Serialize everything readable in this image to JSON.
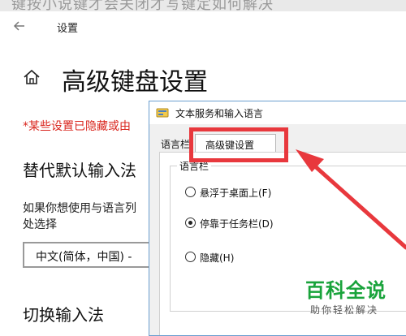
{
  "top_strip_text": "键按小说键才会关闭才写键定如何解决",
  "settings": {
    "title": "设置",
    "page_title": "高级键盘设置",
    "notice": "*某些设置已隐藏或由",
    "section1_heading": "替代默认输入法",
    "section1_desc_line1": "如果你想使用与语言列",
    "section1_desc_line2": "处选择",
    "input_method_select": "中文(简体，中国) -",
    "section2_heading": "切换输入法"
  },
  "dialog": {
    "title": "文本服务和输入语言",
    "tabs": [
      "语言栏",
      "高级键设置"
    ],
    "group_title": "语言栏",
    "options": [
      {
        "label": "悬浮于桌面上(F)",
        "selected": false
      },
      {
        "label": "停靠于任务栏(D)",
        "selected": true
      },
      {
        "label": "隐藏(H)",
        "selected": false
      }
    ]
  },
  "annotation": {
    "color": "#e8383d"
  },
  "watermark": {
    "title": "百科全说",
    "subtitle": "助你轻松解决",
    "color": "#19a33b"
  }
}
